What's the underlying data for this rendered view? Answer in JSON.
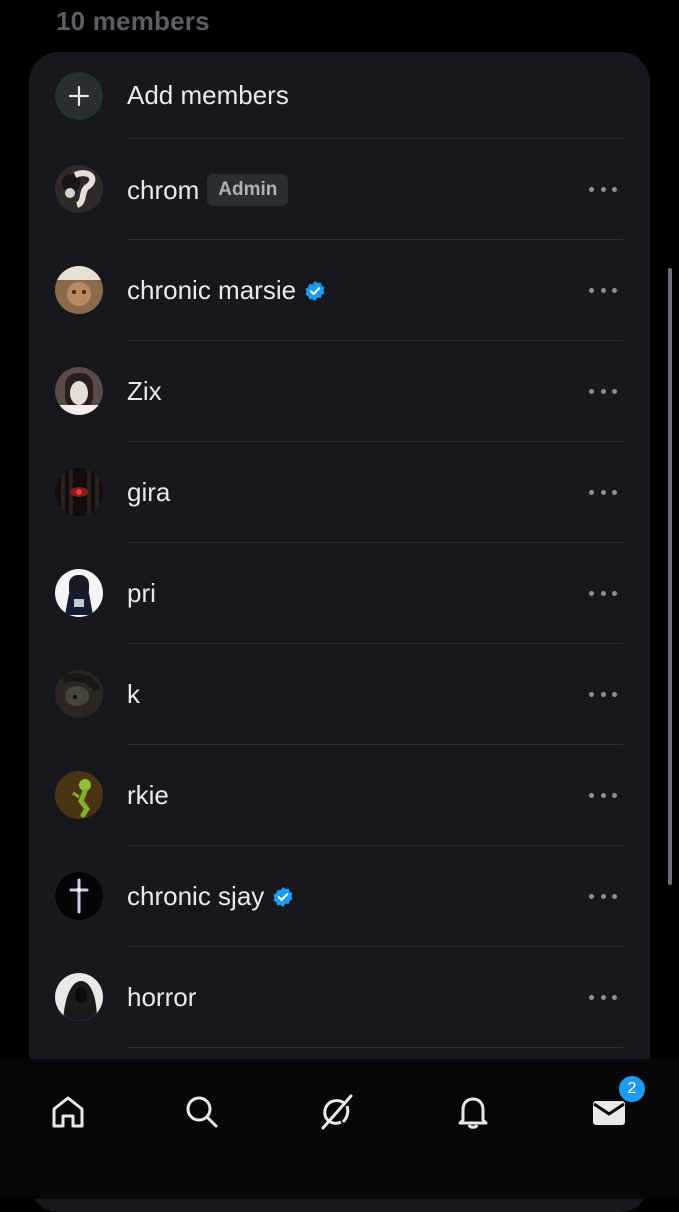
{
  "header": {
    "members_count": "10 members"
  },
  "add_members": {
    "label": "Add members",
    "icon": "plus-icon"
  },
  "members": [
    {
      "name": "chrom",
      "badge": "Admin",
      "verified": false
    },
    {
      "name": "chronic marsie",
      "badge": "",
      "verified": true
    },
    {
      "name": "Zix",
      "badge": "",
      "verified": false
    },
    {
      "name": "gira",
      "badge": "",
      "verified": false
    },
    {
      "name": "pri",
      "badge": "",
      "verified": false
    },
    {
      "name": "k",
      "badge": "",
      "verified": false
    },
    {
      "name": "rkie",
      "badge": "",
      "verified": false
    },
    {
      "name": "chronic sjay",
      "badge": "",
      "verified": true
    },
    {
      "name": "horror",
      "badge": "",
      "verified": false
    }
  ],
  "tabbar": {
    "items": [
      "home-icon",
      "search-icon",
      "grok-icon",
      "bell-icon",
      "mail-icon"
    ],
    "messages_badge": "2"
  },
  "colors": {
    "background": "#000000",
    "card": "#17181c",
    "verified": "#1d9bf0",
    "text": "#e7e9ea",
    "muted": "#5b5f65"
  }
}
